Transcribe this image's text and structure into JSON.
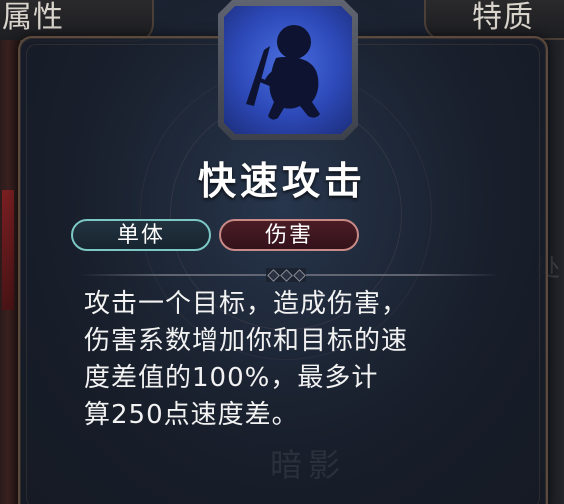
{
  "background": {
    "left_tab": "属性",
    "right_tab": "特质",
    "right_edge_char": "处",
    "bottom_faint_text": "暗影"
  },
  "skill": {
    "icon": "assassin-dagger-silhouette-icon",
    "title": "快速攻击",
    "tags": {
      "target": "单体",
      "effect": "伤害"
    },
    "description": "攻击一个目标，造成伤害，\n伤害系数增加你和目标的速\n度差值的100%，最多计\n算250点速度差。"
  },
  "colors": {
    "title_text": "#ffffff",
    "tag_target_border": "#7bc8c4",
    "tag_effect_border": "#c88a86",
    "icon_background": "#2d49b8",
    "panel_border": "#5b4a3c"
  }
}
